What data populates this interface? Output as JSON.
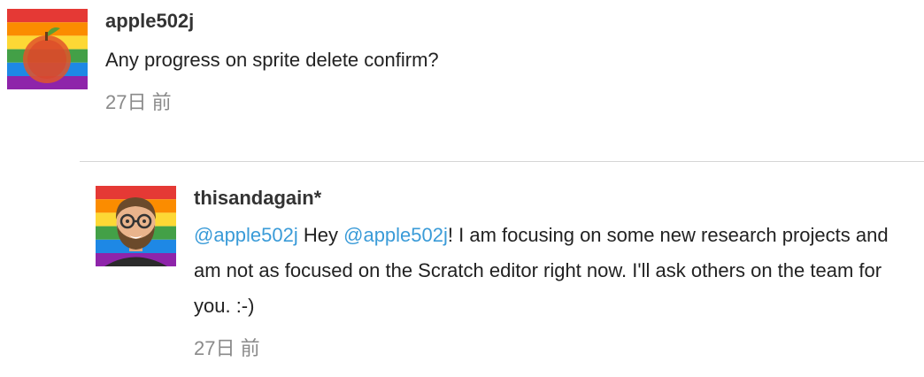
{
  "comments": [
    {
      "username": "apple502j",
      "text": "Any progress on sprite delete confirm?",
      "timestamp": "27日 前",
      "avatar_icon": "apple-rainbow-avatar-icon"
    }
  ],
  "reply": {
    "username": "thisandagain*",
    "mention1": "@apple502j",
    "text_part1": " Hey ",
    "mention2": "@apple502j",
    "text_part2": "! I am focusing on some new research projects and am not as focused on the Scratch editor right now. I'll ask others on the team for you. :-)",
    "timestamp": "27日 前",
    "avatar_icon": "bearded-man-rainbow-avatar-icon"
  },
  "colors": {
    "mention": "#3a9bd8",
    "timestamp": "#8a8a8a",
    "divider": "#d6d6d6",
    "rainbow": [
      "#e53935",
      "#fb8c00",
      "#fdd835",
      "#43a047",
      "#1e88e5",
      "#8e24aa"
    ]
  }
}
